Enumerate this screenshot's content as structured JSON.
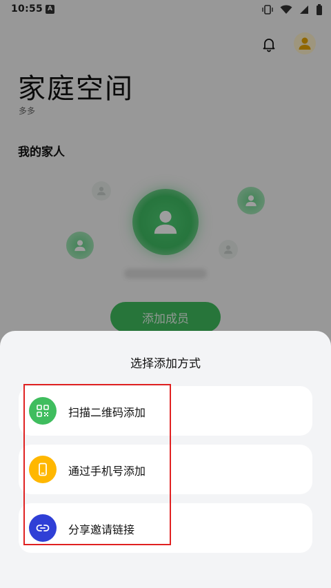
{
  "status_bar": {
    "time": "10:55",
    "app_badge": "A"
  },
  "header": {
    "title": "家庭空间",
    "subtitle": "多多"
  },
  "members_section": {
    "title": "我的家人",
    "add_button_label": "添加成员"
  },
  "sheet": {
    "title": "选择添加方式",
    "options": [
      {
        "label": "扫描二维码添加",
        "icon": "qr-code-icon",
        "color": "#3fbd5e"
      },
      {
        "label": "通过手机号添加",
        "icon": "phone-icon",
        "color": "#ffb700"
      },
      {
        "label": "分享邀请链接",
        "icon": "link-icon",
        "color": "#2f3fd6"
      }
    ]
  },
  "colors": {
    "accent_green": "#3fbd5e",
    "highlight_red": "#e02020"
  }
}
